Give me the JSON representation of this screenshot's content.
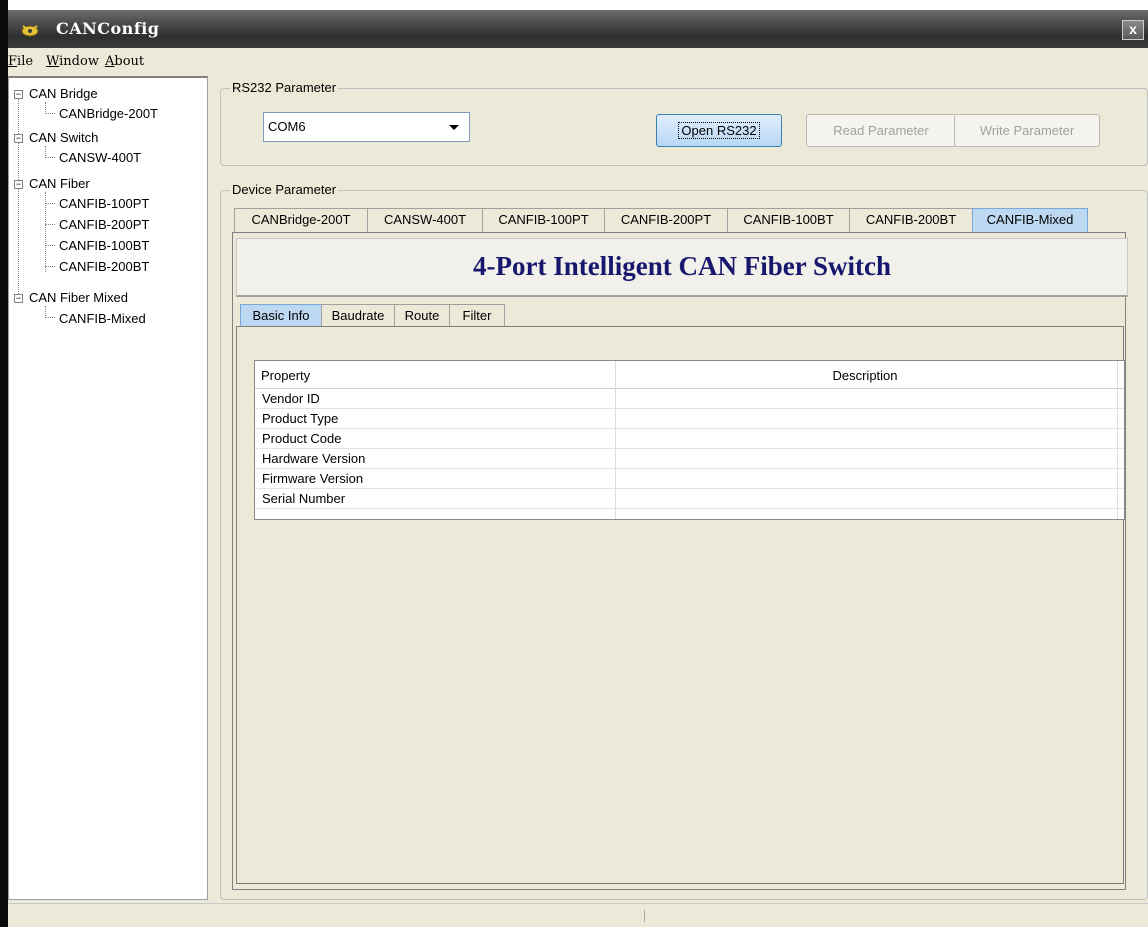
{
  "window": {
    "title": "CANConfig",
    "close_label": "x",
    "icon": "app-logo-icon"
  },
  "menu": [
    {
      "label": "File",
      "key": "F",
      "rest": "ile"
    },
    {
      "label": "Window",
      "key": "W",
      "rest": "indow"
    },
    {
      "label": "About",
      "key": "A",
      "rest": "bout"
    }
  ],
  "tree": {
    "groups": [
      {
        "label": "CAN Bridge",
        "expander": "−",
        "children": [
          "CANBridge-200T"
        ]
      },
      {
        "label": "CAN Switch",
        "expander": "−",
        "children": [
          "CANSW-400T"
        ]
      },
      {
        "label": "CAN Fiber",
        "expander": "−",
        "children": [
          "CANFIB-100PT",
          "CANFIB-200PT",
          "CANFIB-100BT",
          "CANFIB-200BT"
        ]
      },
      {
        "label": "CAN Fiber Mixed",
        "expander": "−",
        "children": [
          "CANFIB-Mixed"
        ]
      }
    ]
  },
  "rs232": {
    "group_label": "RS232 Parameter",
    "port_value": "COM6",
    "open_label": "Open RS232",
    "read_label": "Read Parameter",
    "write_label": "Write Parameter"
  },
  "device": {
    "group_label": "Device Parameter",
    "tabs": [
      "CANBridge-200T",
      "CANSW-400T",
      "CANFIB-100PT",
      "CANFIB-200PT",
      "CANFIB-100BT",
      "CANFIB-200BT",
      "CANFIB-Mixed"
    ],
    "selected_tab": "CANFIB-Mixed",
    "header_title": "4-Port Intelligent CAN Fiber Switch",
    "sub_tabs": [
      "Basic Info",
      "Baudrate",
      "Route",
      "Filter"
    ],
    "selected_sub_tab": "Basic Info",
    "table": {
      "columns": [
        "Property",
        "Description"
      ],
      "rows": [
        [
          "Vendor ID",
          ""
        ],
        [
          "Product Type",
          ""
        ],
        [
          "Product Code",
          ""
        ],
        [
          "Hardware Version",
          ""
        ],
        [
          "Firmware Version",
          ""
        ],
        [
          "Serial Number",
          ""
        ]
      ]
    }
  }
}
